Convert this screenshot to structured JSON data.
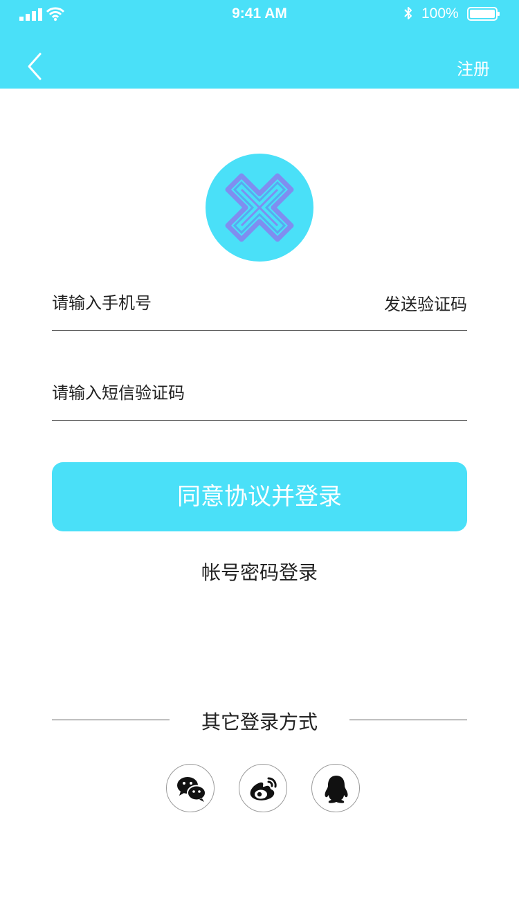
{
  "status_bar": {
    "time": "9:41 AM",
    "battery": "100%"
  },
  "nav": {
    "register_label": "注册"
  },
  "form": {
    "phone_placeholder": "请输入手机号",
    "send_code_label": "发送验证码",
    "code_placeholder": "请输入短信验证码"
  },
  "login_button": "同意协议并登录",
  "alt_login": "帐号密码登录",
  "other_login": {
    "title": "其它登录方式",
    "icons": [
      "wechat-icon",
      "weibo-icon",
      "qq-icon"
    ]
  },
  "colors": {
    "brand": "#4ae0f8",
    "logo_mark": "#7f8ef0"
  }
}
